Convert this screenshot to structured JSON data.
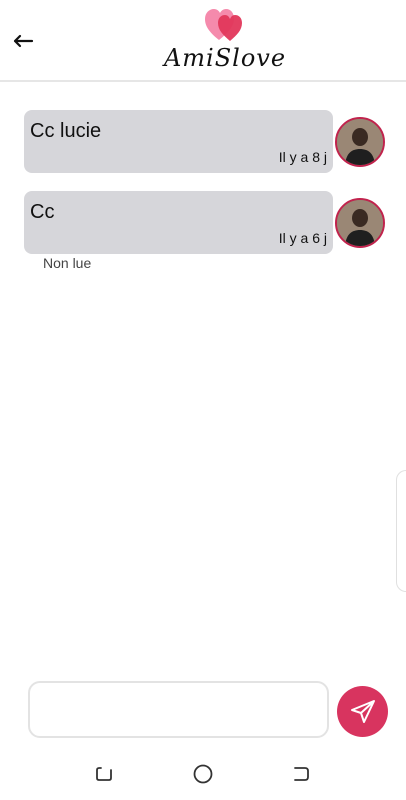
{
  "header": {
    "app_name": "AmiSlove",
    "back_icon": "arrow-left-icon",
    "logo_icon": "hearts-icon",
    "logo_colors": [
      "#f47fa7",
      "#e23b5f"
    ]
  },
  "messages": [
    {
      "text": "Cc lucie",
      "time": "Il y a 8 j"
    },
    {
      "text": "Cc",
      "time": "Il y a 6 j",
      "status": "Non lue"
    }
  ],
  "composer": {
    "placeholder": "",
    "send_icon": "paper-plane-icon"
  },
  "accent_color": "#d8345f",
  "navbar": {
    "recent_icon": "recent-apps-icon",
    "home_icon": "home-circle-icon",
    "back_icon": "nav-back-icon"
  }
}
